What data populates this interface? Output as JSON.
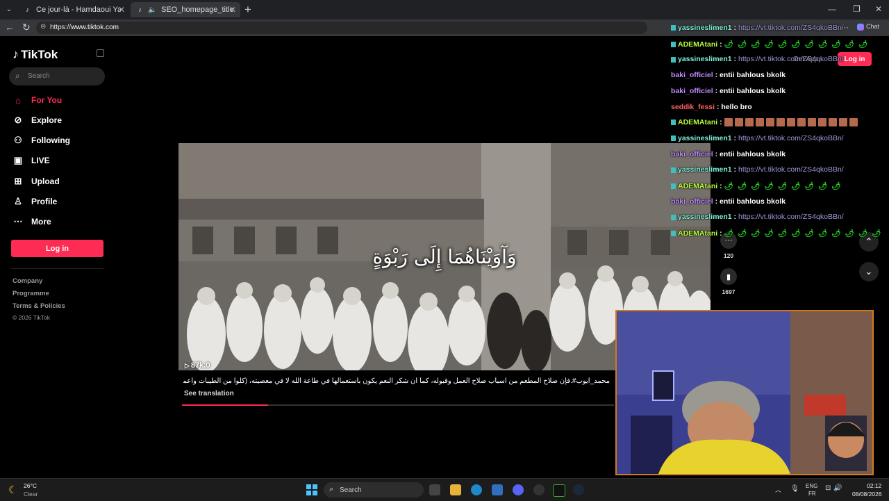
{
  "browser": {
    "tabs": [
      {
        "title": "Ce jour-là - Hamdaoui Yassmine (\\",
        "close": "✕"
      },
      {
        "title": "SEO_homepage_title",
        "close": "✕"
      }
    ],
    "new_tab": "+",
    "url_prefix": "https://",
    "url_host": "www.tiktok.com",
    "window_controls": [
      "—",
      "❐",
      "✕"
    ],
    "profile_badge": "Incognito",
    "chat_label": "Chat"
  },
  "tiktok": {
    "logo": "TikTok",
    "search_placeholder": "Search",
    "nav": [
      {
        "label": "For You",
        "icon": "home-icon",
        "active": true
      },
      {
        "label": "Explore",
        "icon": "compass-icon"
      },
      {
        "label": "Following",
        "icon": "following-icon"
      },
      {
        "label": "LIVE",
        "icon": "live-icon"
      },
      {
        "label": "Upload",
        "icon": "upload-icon"
      },
      {
        "label": "Profile",
        "icon": "profile-icon"
      },
      {
        "label": "More",
        "icon": "more-icon"
      }
    ],
    "login_button": "Log in",
    "footer": {
      "company": "Company",
      "programme": "Programme",
      "terms": "Terms & Policies",
      "copyright": "© 2026 TikTok"
    },
    "get_app": "Get App",
    "header_login": "Log in",
    "accent": "#fe2c55"
  },
  "video": {
    "caption": "وَآوَيْنَاهُمَا إِلَى رَبْوَةٍ",
    "views": "87k.0",
    "description": "محمد_أيوب#.فإن صلاح المطعم من أسباب صلاح العمل وقبوله، كما أن شكر النعم يكون باستعمالها في طاعة الله لا في معصيته، (كلوا من الطيبات واعملوا صالحًا)",
    "see_translation": "See translation",
    "progress": 0.2
  },
  "actions": {
    "comments": "120",
    "saves": "1697"
  },
  "chat": [
    {
      "user": "yassineslimen1",
      "text": "https://vt.tiktok.com/ZS4qkoBBn/",
      "type": "link",
      "color": "u-cyan",
      "badge": true
    },
    {
      "user": "ADEMAtani",
      "text": "🌶🌶🌶🌶🌶🌶🌶🌶🌶🌶🌶",
      "type": "emoji",
      "color": "u-green",
      "badge": true
    },
    {
      "user": "yassineslimen1",
      "text": "https://vt.tiktok.com/ZS4qkoBBn/",
      "type": "link",
      "color": "u-cyan",
      "badge": true
    },
    {
      "user": "baki_officiel",
      "text": "entii bahlous bkolk",
      "type": "msg",
      "color": "u-purple",
      "badge": false
    },
    {
      "user": "baki_officiel",
      "text": "entii bahlous bkolk",
      "type": "msg",
      "color": "u-purple",
      "badge": false
    },
    {
      "user": "seddik_fessi",
      "text": "hello bro",
      "type": "msg",
      "color": "u-red",
      "badge": false
    },
    {
      "user": "ADEMAtani",
      "text": "",
      "type": "boxes",
      "count": 13,
      "color": "u-green",
      "badge": true
    },
    {
      "user": "yassineslimen1",
      "text": "https://vt.tiktok.com/ZS4qkoBBn/",
      "type": "link",
      "color": "u-cyan",
      "badge": true
    },
    {
      "user": "baki_officiel",
      "text": "entii bahlous bkolk",
      "type": "msg",
      "color": "u-purple",
      "badge": false
    },
    {
      "user": "yassineslimen1",
      "text": "https://vt.tiktok.com/ZS4qkoBBn/",
      "type": "link",
      "color": "u-cyan",
      "badge": true
    },
    {
      "user": "ADEMAtani",
      "text": "🌶🌶🌶🌶🌶🌶🌶🌶🌶",
      "type": "emoji",
      "color": "u-green",
      "badge": true
    },
    {
      "user": "baki_officiel",
      "text": "entii bahlous bkolk",
      "type": "msg",
      "color": "u-purple",
      "badge": false
    },
    {
      "user": "yassineslimen1",
      "text": "https://vt.tiktok.com/ZS4qkoBBn/",
      "type": "link",
      "color": "u-cyan",
      "badge": true
    },
    {
      "user": "ADEMAtani",
      "text": "🌶🌶🌶🌶🌶🌶🌶🌶🌶🌶🌶🌶",
      "type": "emoji",
      "color": "u-green",
      "badge": true
    }
  ],
  "taskbar": {
    "weather_temp": "26°C",
    "weather_cond": "Clear",
    "search_placeholder": "Search",
    "lang_line1": "ENG",
    "lang_line2": "FR",
    "time": "02:12",
    "date": "08/08/2026"
  }
}
